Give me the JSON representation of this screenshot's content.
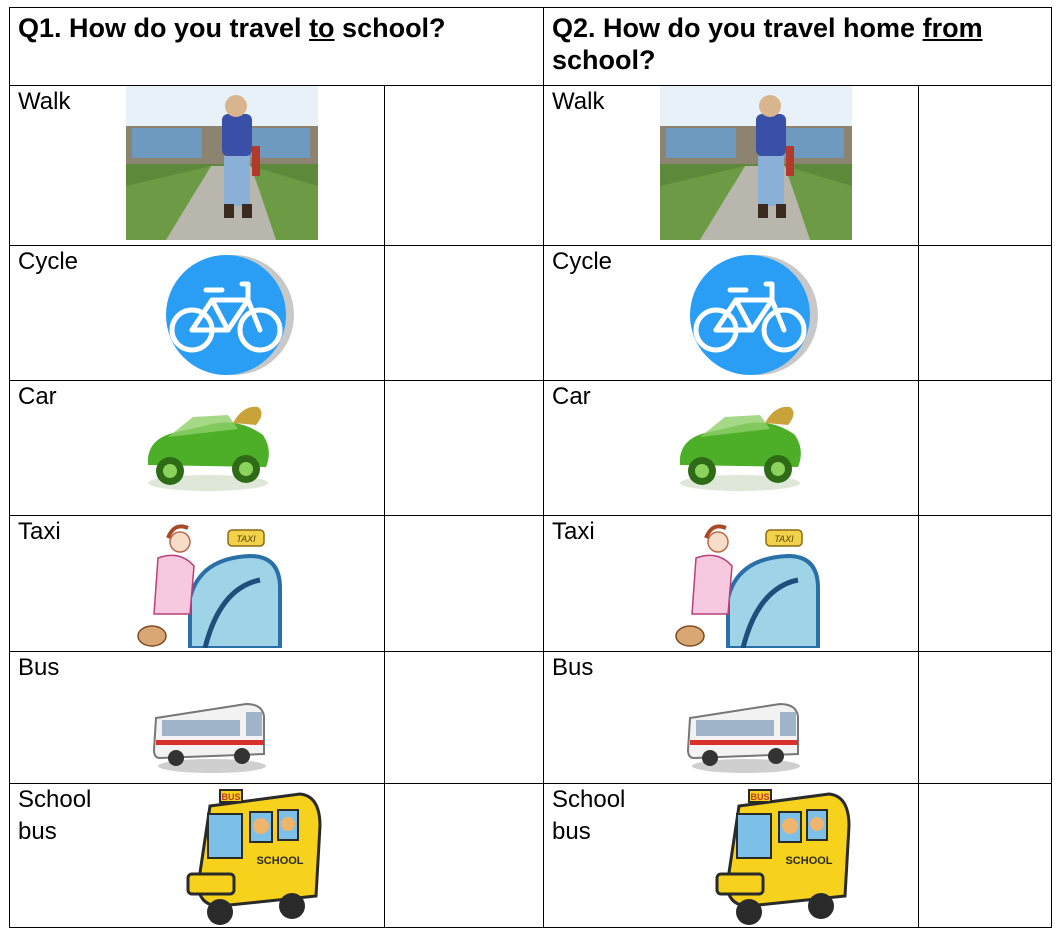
{
  "q1": {
    "part1": "Q1.  How do you travel ",
    "underlined": "to",
    "part2": " school?"
  },
  "q2": {
    "part1": "Q2.  How do you travel home ",
    "underlined": "from",
    "part2": " school?"
  },
  "modes": [
    {
      "label": "Walk",
      "icon": "child-walking-to-school-photo"
    },
    {
      "label": "Cycle",
      "icon": "blue-bicycle-sign-icon"
    },
    {
      "label": "Car",
      "icon": "green-car-icon"
    },
    {
      "label": "Taxi",
      "icon": "woman-at-taxi-icon"
    },
    {
      "label": "Bus",
      "icon": "city-bus-icon"
    },
    {
      "label": "School bus",
      "icon": "yellow-school-bus-icon",
      "label_line1": "School",
      "label_line2": "bus"
    }
  ],
  "images": {
    "bus_sign_text": "BUS",
    "school_bus_side_text": "SCHOOL",
    "taxi_sign_text": "TAXI"
  },
  "colors": {
    "cycle_sign": "#2a9df4",
    "car_green": "#4caf27",
    "school_bus_yellow": "#f6d21c",
    "bus_stripe": "#d9302c"
  }
}
